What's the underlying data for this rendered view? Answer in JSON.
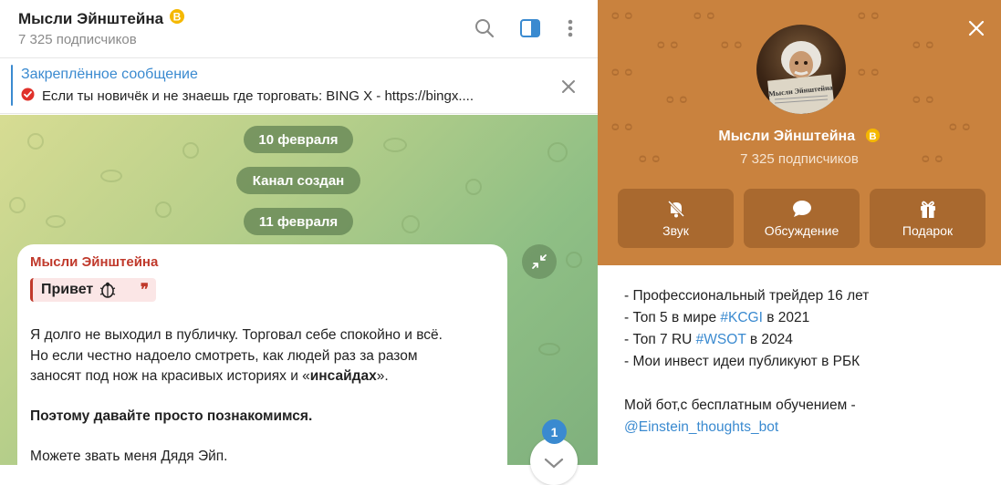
{
  "header": {
    "title": "Мысли Эйнштейна",
    "subtitle": "7 325 подписчиков"
  },
  "pinned": {
    "title": "Закреплённое сообщение",
    "text": "Если ты новичёк и не знаешь где торговать:  BING X - https://bingx...."
  },
  "service": {
    "date1": "10 февраля",
    "created": "Канал создан",
    "date2": "11 февраля"
  },
  "message": {
    "author": "Мысли Эйнштейна",
    "quote": "Привет",
    "p1_l1": "Я долго не выходил в публичку. Торговал себе спокойно и всё.",
    "p1_l2": "Но если честно надоело смотреть, как людей раз за разом",
    "p1_l3_a": "заносят под нож на красивых историях и «",
    "p1_l3_b": "инсайдах",
    "p1_l3_c": "».",
    "p2": "Поэтому давайте просто познакомимся.",
    "p3": "Можете звать меня Дядя Эйп."
  },
  "unread_count": "1",
  "profile": {
    "name": "Мысли Эйнштейна",
    "subscribers": "7 325 подписчиков",
    "avatar_caption": "Мысли Эйнштейна",
    "actions": [
      {
        "label": "Звук",
        "icon": "bell-off-icon"
      },
      {
        "label": "Обсуждение",
        "icon": "chat-bubble-icon"
      },
      {
        "label": "Подарок",
        "icon": "gift-icon"
      }
    ],
    "about": {
      "l1": "- Профессиональный трейдер 16 лет",
      "l2_a": "- Топ 5 в мире ",
      "l2_tag": "#KCGI",
      "l2_b": " в 2021",
      "l3_a": "- Топ 7 RU ",
      "l3_tag": "#WSOT",
      "l3_b": " в 2024",
      "l4": "- Мои инвест идеи публикуют в РБК",
      "l5": "Мой бот,с бесплатным обучением -",
      "l6": "@Einstein_thoughts_bot"
    }
  },
  "colors": {
    "accent": "#3a8ad0",
    "profile_bg": "#c9823e",
    "author": "#c0392b"
  }
}
